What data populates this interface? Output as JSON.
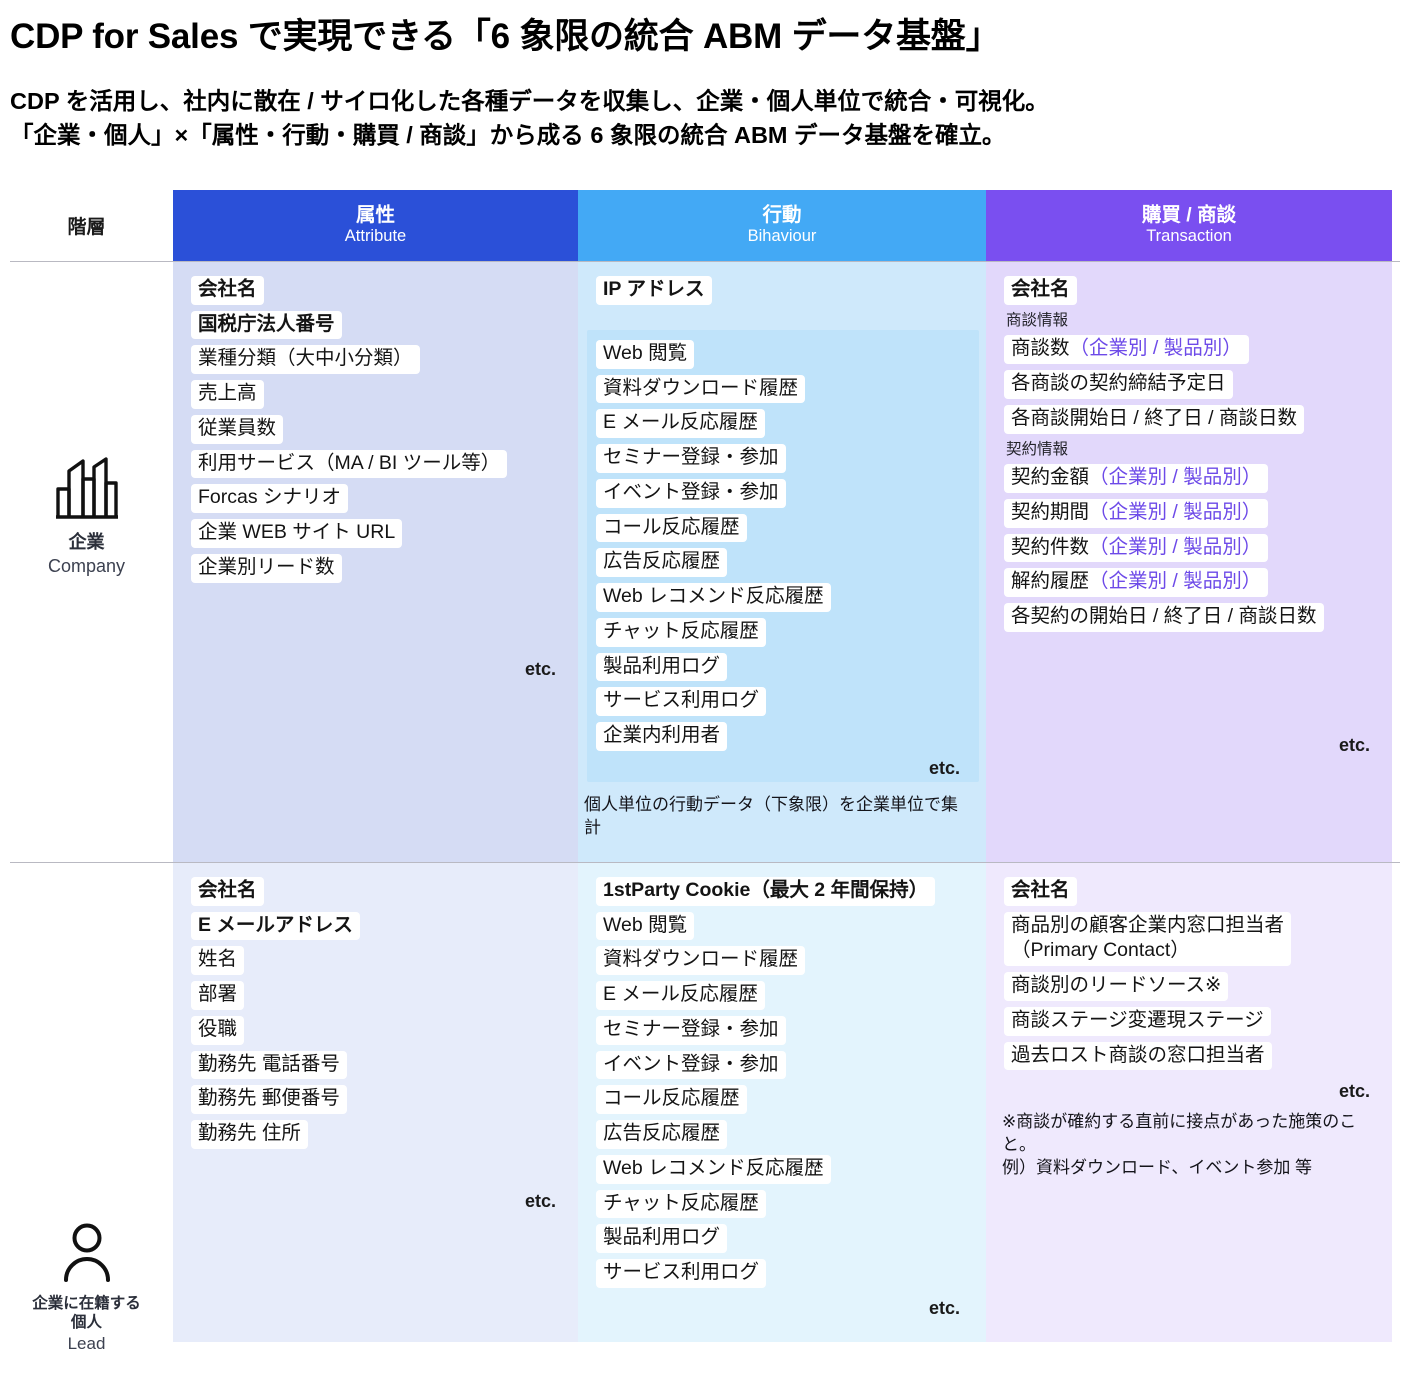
{
  "header": {
    "title": "CDP for Sales で実現できる「6 象限の統合 ABM データ基盤」",
    "lede_line1": "CDP を活用し、社内に散在 / サイロ化した各種データを収集し、企業・個人単位で統合・可視化。",
    "lede_line2": "「企業・個人」×「属性・行動・購買 / 商談」から成る 6 象限の統合 ABM データ基盤を確立。"
  },
  "colors": {
    "attribute_header": "#2b50d8",
    "behaviour_header": "#43a9f5",
    "transaction_header": "#7a4ff0",
    "accent_purple_text": "#6d4ae8"
  },
  "matrix": {
    "corner_label": "階層",
    "columns": [
      {
        "jp": "属性",
        "en": "Attribute"
      },
      {
        "jp": "行動",
        "en": "Bihaviour"
      },
      {
        "jp": "購買 / 商談",
        "en": "Transaction"
      }
    ],
    "rows": [
      {
        "icon": "building-icon",
        "jp": "企業",
        "en": "Company"
      },
      {
        "icon": "person-icon",
        "jp_line1": "企業に在籍する",
        "jp_line2": "個人",
        "en": "Lead"
      }
    ]
  },
  "cells": {
    "company_attribute": {
      "items": [
        {
          "text": "会社名",
          "bold": true
        },
        {
          "text": "国税庁法人番号",
          "bold": true
        },
        {
          "text": "業種分類（大中小分類）",
          "bold": false
        },
        {
          "text": "売上高",
          "bold": false
        },
        {
          "text": "従業員数",
          "bold": false
        },
        {
          "text": "利用サービス（MA / BI ツール等）",
          "bold": false
        },
        {
          "text": "Forcas シナリオ",
          "bold": false
        },
        {
          "text": "企業 WEB サイト URL",
          "bold": false
        },
        {
          "text": "企業別リード数",
          "bold": false
        }
      ],
      "etc": "etc."
    },
    "company_behaviour": {
      "headline": {
        "text": "IP アドレス",
        "bold": true
      },
      "items": [
        {
          "text": "Web 閲覧"
        },
        {
          "text": "資料ダウンロード履歴"
        },
        {
          "text": "E メール反応履歴"
        },
        {
          "text": "セミナー登録・参加"
        },
        {
          "text": "イベント登録・参加"
        },
        {
          "text": "コール反応履歴"
        },
        {
          "text": "広告反応履歴"
        },
        {
          "text": "Web レコメンド反応履歴"
        },
        {
          "text": "チャット反応履歴"
        },
        {
          "text": "製品利用ログ"
        },
        {
          "text": "サービス利用ログ"
        },
        {
          "text": "企業内利用者"
        }
      ],
      "etc": "etc.",
      "note": "個人単位の行動データ（下象限）を企業単位で集計"
    },
    "company_transaction": {
      "headline": {
        "text": "会社名",
        "bold": true
      },
      "group1_label": "商談情報",
      "group1_items": [
        {
          "main": "商談数",
          "sub": "（企業別 / 製品別）"
        },
        {
          "main": "各商談の契約締結予定日",
          "sub": ""
        },
        {
          "main": "各商談開始日 / 終了日 / 商談日数",
          "sub": ""
        }
      ],
      "group2_label": "契約情報",
      "group2_items": [
        {
          "main": "契約金額",
          "sub": "（企業別 / 製品別）"
        },
        {
          "main": "契約期間",
          "sub": "（企業別 / 製品別）"
        },
        {
          "main": "契約件数",
          "sub": "（企業別 / 製品別）"
        },
        {
          "main": "解約履歴",
          "sub": "（企業別 / 製品別）"
        },
        {
          "main": "各契約の開始日 / 終了日 / 商談日数",
          "sub": ""
        }
      ],
      "etc": "etc."
    },
    "lead_attribute": {
      "items": [
        {
          "text": "会社名",
          "bold": true
        },
        {
          "text": "E メールアドレス",
          "bold": true
        },
        {
          "text": "姓名",
          "bold": false
        },
        {
          "text": "部署",
          "bold": false
        },
        {
          "text": "役職",
          "bold": false
        },
        {
          "text": "勤務先 電話番号",
          "bold": false
        },
        {
          "text": "勤務先 郵便番号",
          "bold": false
        },
        {
          "text": "勤務先 住所",
          "bold": false
        }
      ],
      "etc": "etc."
    },
    "lead_behaviour": {
      "headline": {
        "text": "1stParty Cookie（最大 2 年間保持）",
        "bold": true
      },
      "items": [
        {
          "text": "Web 閲覧"
        },
        {
          "text": "資料ダウンロード履歴"
        },
        {
          "text": "E メール反応履歴"
        },
        {
          "text": "セミナー登録・参加"
        },
        {
          "text": "イベント登録・参加"
        },
        {
          "text": "コール反応履歴"
        },
        {
          "text": "広告反応履歴"
        },
        {
          "text": "Web レコメンド反応履歴"
        },
        {
          "text": "チャット反応履歴"
        },
        {
          "text": "製品利用ログ"
        },
        {
          "text": "サービス利用ログ"
        }
      ],
      "etc": "etc."
    },
    "lead_transaction": {
      "headline": {
        "text": "会社名",
        "bold": true
      },
      "items": [
        {
          "text": "商品別の顧客企業内窓口担当者",
          "text2": "（Primary Contact）"
        },
        {
          "text": "商談別のリードソース※"
        },
        {
          "text": "商談ステージ変遷現ステージ"
        },
        {
          "text": "過去ロスト商談の窓口担当者"
        }
      ],
      "etc": "etc.",
      "note_line1": "※商談が確約する直前に接点があった施策のこ",
      "note_line2": "と。",
      "note_line3": "例）資料ダウンロード、イベント参加 等"
    }
  }
}
